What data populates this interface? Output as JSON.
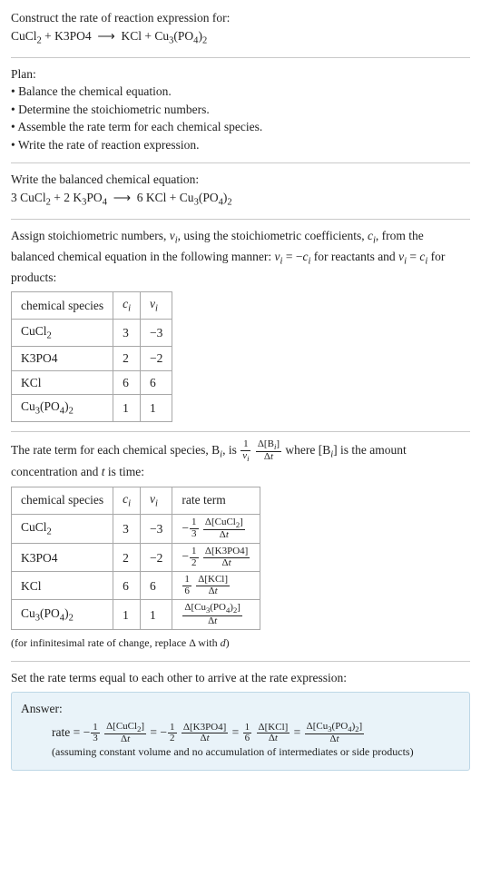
{
  "header": {
    "prompt": "Construct the rate of reaction expression for:",
    "equation_html": "CuCl<sub>2</sub> + K3PO4&nbsp;&nbsp;⟶&nbsp;&nbsp;KCl + Cu<sub>3</sub>(PO<sub>4</sub>)<sub>2</sub>"
  },
  "plan": {
    "title": "Plan:",
    "items": [
      "• Balance the chemical equation.",
      "• Determine the stoichiometric numbers.",
      "• Assemble the rate term for each chemical species.",
      "• Write the rate of reaction expression."
    ]
  },
  "balanced": {
    "title": "Write the balanced chemical equation:",
    "equation_html": "3 CuCl<sub>2</sub> + 2 K<sub>3</sub>PO<sub>4</sub>&nbsp;&nbsp;⟶&nbsp;&nbsp;6 KCl + Cu<sub>3</sub>(PO<sub>4</sub>)<sub>2</sub>"
  },
  "stoich": {
    "intro_html": "Assign stoichiometric numbers, <span class=\"italic\">ν<sub>i</sub></span>, using the stoichiometric coefficients, <span class=\"italic\">c<sub>i</sub></span>, from the balanced chemical equation in the following manner: <span class=\"italic\">ν<sub>i</sub></span> = −<span class=\"italic\">c<sub>i</sub></span> for reactants and <span class=\"italic\">ν<sub>i</sub></span> = <span class=\"italic\">c<sub>i</sub></span> for products:",
    "headers": {
      "species": "chemical species",
      "ci_html": "<span class=\"italic\">c<sub>i</sub></span>",
      "vi_html": "<span class=\"italic\">ν<sub>i</sub></span>"
    },
    "rows": [
      {
        "species_html": "CuCl<sub>2</sub>",
        "ci": "3",
        "vi": "−3"
      },
      {
        "species_html": "K3PO4",
        "ci": "2",
        "vi": "−2"
      },
      {
        "species_html": "KCl",
        "ci": "6",
        "vi": "6"
      },
      {
        "species_html": "Cu<sub>3</sub>(PO<sub>4</sub>)<sub>2</sub>",
        "ci": "1",
        "vi": "1"
      }
    ]
  },
  "rateterm": {
    "intro_html": "The rate term for each chemical species, B<sub><span class=\"italic\">i</span></sub>, is <span class=\"frac\"><span class=\"num\">1</span><span class=\"den\"><span class=\"italic\">ν<sub>i</sub></span></span></span> <span class=\"frac\"><span class=\"num\">Δ[B<sub><span class=\"italic\">i</span></sub>]</span><span class=\"den\">Δ<span class=\"italic\">t</span></span></span> where [B<sub><span class=\"italic\">i</span></sub>] is the amount concentration and <span class=\"italic\">t</span> is time:",
    "headers": {
      "species": "chemical species",
      "ci_html": "<span class=\"italic\">c<sub>i</sub></span>",
      "vi_html": "<span class=\"italic\">ν<sub>i</sub></span>",
      "rate": "rate term"
    },
    "rows": [
      {
        "species_html": "CuCl<sub>2</sub>",
        "ci": "3",
        "vi": "−3",
        "rate_html": "−<span class=\"frac\"><span class=\"num\">1</span><span class=\"den\">3</span></span> <span class=\"frac\"><span class=\"num\">Δ[CuCl<sub>2</sub>]</span><span class=\"den\">Δ<span class=\"italic\">t</span></span></span>"
      },
      {
        "species_html": "K3PO4",
        "ci": "2",
        "vi": "−2",
        "rate_html": "−<span class=\"frac\"><span class=\"num\">1</span><span class=\"den\">2</span></span> <span class=\"frac\"><span class=\"num\">Δ[K3PO4]</span><span class=\"den\">Δ<span class=\"italic\">t</span></span></span>"
      },
      {
        "species_html": "KCl",
        "ci": "6",
        "vi": "6",
        "rate_html": "<span class=\"frac\"><span class=\"num\">1</span><span class=\"den\">6</span></span> <span class=\"frac\"><span class=\"num\">Δ[KCl]</span><span class=\"den\">Δ<span class=\"italic\">t</span></span></span>"
      },
      {
        "species_html": "Cu<sub>3</sub>(PO<sub>4</sub>)<sub>2</sub>",
        "ci": "1",
        "vi": "1",
        "rate_html": "<span class=\"frac\"><span class=\"num\">Δ[Cu<sub>3</sub>(PO<sub>4</sub>)<sub>2</sub>]</span><span class=\"den\">Δ<span class=\"italic\">t</span></span></span>"
      }
    ],
    "note_html": "(for infinitesimal rate of change, replace Δ with <span class=\"italic\">d</span>)"
  },
  "final": {
    "intro": "Set the rate terms equal to each other to arrive at the rate expression:",
    "answer_label": "Answer:",
    "rate_html": "rate = −<span class=\"frac\"><span class=\"num\">1</span><span class=\"den\">3</span></span> <span class=\"frac\"><span class=\"num\">Δ[CuCl<sub>2</sub>]</span><span class=\"den\">Δ<span class=\"italic\">t</span></span></span> = −<span class=\"frac\"><span class=\"num\">1</span><span class=\"den\">2</span></span> <span class=\"frac\"><span class=\"num\">Δ[K3PO4]</span><span class=\"den\">Δ<span class=\"italic\">t</span></span></span> = <span class=\"frac\"><span class=\"num\">1</span><span class=\"den\">6</span></span> <span class=\"frac\"><span class=\"num\">Δ[KCl]</span><span class=\"den\">Δ<span class=\"italic\">t</span></span></span> = <span class=\"frac\"><span class=\"num\">Δ[Cu<sub>3</sub>(PO<sub>4</sub>)<sub>2</sub>]</span><span class=\"den\">Δ<span class=\"italic\">t</span></span></span>",
    "assumption": "(assuming constant volume and no accumulation of intermediates or side products)"
  }
}
